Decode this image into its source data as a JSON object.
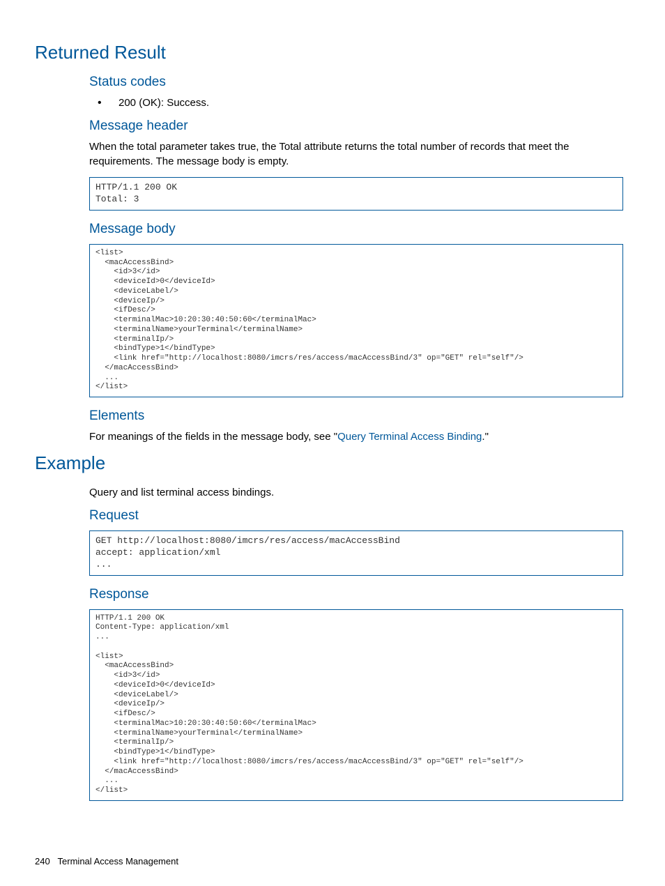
{
  "h1_returned": "Returned Result",
  "h2_status": "Status codes",
  "status_item": "200 (OK): Success.",
  "h2_msgheader": "Message header",
  "msgheader_text": "When the total parameter takes true, the Total attribute returns the total number of records that meet the requirements. The message body is empty.",
  "code_header": "HTTP/1.1 200 OK\nTotal: 3",
  "h2_msgbody": "Message body",
  "code_body": "<list>\n  <macAccessBind>\n    <id>3</id>\n    <deviceId>0</deviceId>\n    <deviceLabel/>\n    <deviceIp/>\n    <ifDesc/>\n    <terminalMac>10:20:30:40:50:60</terminalMac>\n    <terminalName>yourTerminal</terminalName>\n    <terminalIp/>\n    <bindType>1</bindType>\n    <link href=\"http://localhost:8080/imcrs/res/access/macAccessBind/3\" op=\"GET\" rel=\"self\"/>\n  </macAccessBind>\n  ...\n</list>",
  "h2_elements": "Elements",
  "elements_t1": "For meanings of the fields in the message body, see \"",
  "elements_link": "Query Terminal Access Binding",
  "elements_t2": ".\"",
  "h1_example": "Example",
  "example_text": "Query and list terminal access bindings.",
  "h2_request": "Request",
  "code_request": "GET http://localhost:8080/imcrs/res/access/macAccessBind\naccept: application/xml\n...",
  "h2_response": "Response",
  "code_response": "HTTP/1.1 200 OK\nContent-Type: application/xml\n...\n\n<list>\n  <macAccessBind>\n    <id>3</id>\n    <deviceId>0</deviceId>\n    <deviceLabel/>\n    <deviceIp/>\n    <ifDesc/>\n    <terminalMac>10:20:30:40:50:60</terminalMac>\n    <terminalName>yourTerminal</terminalName>\n    <terminalIp/>\n    <bindType>1</bindType>\n    <link href=\"http://localhost:8080/imcrs/res/access/macAccessBind/3\" op=\"GET\" rel=\"self\"/>\n  </macAccessBind>\n  ...\n</list>",
  "footer_page": "240",
  "footer_title": "Terminal Access Management"
}
